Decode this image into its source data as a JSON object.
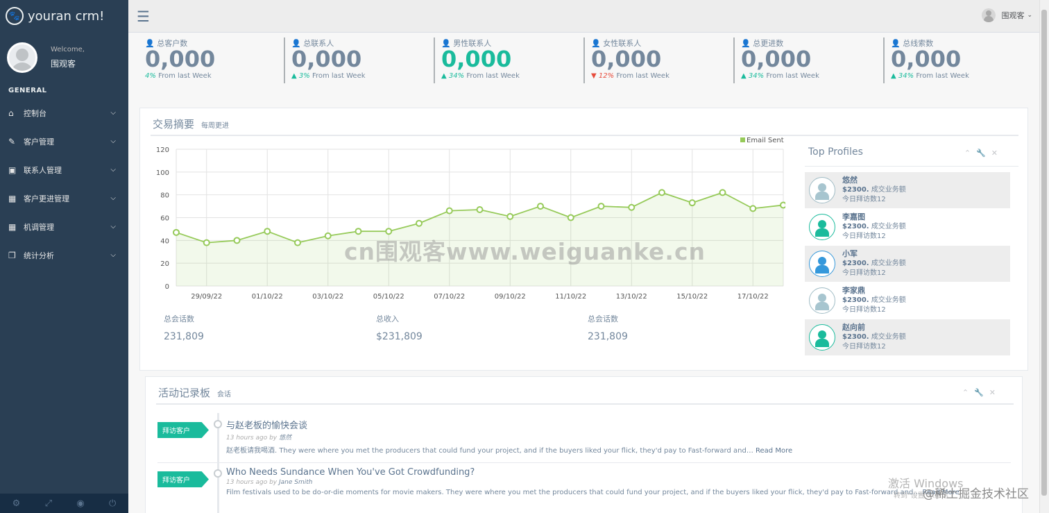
{
  "brand": {
    "icon": "paw-icon",
    "title": "youran crm!"
  },
  "profile": {
    "welcome": "Welcome,",
    "name": "围观客"
  },
  "sidebar": {
    "section": "GENERAL",
    "items": [
      {
        "label": "控制台",
        "icon": "home-icon"
      },
      {
        "label": "客户管理",
        "icon": "edit-icon"
      },
      {
        "label": "联系人管理",
        "icon": "desktop-icon"
      },
      {
        "label": "客户更进管理",
        "icon": "table-icon"
      },
      {
        "label": "机调管理",
        "icon": "table-icon"
      },
      {
        "label": "统计分析",
        "icon": "clone-icon"
      }
    ],
    "footer_icons": [
      "gear-icon",
      "fullscreen-icon",
      "eye-slash-icon",
      "power-icon"
    ]
  },
  "topnav": {
    "user": "围观客"
  },
  "stats": [
    {
      "title": "总客户数",
      "value": "0,000",
      "change": "4%",
      "dir": "none",
      "suffix": "From last Week",
      "green": false
    },
    {
      "title": "总联系人",
      "value": "0,000",
      "change": "3%",
      "dir": "up",
      "suffix": "From last Week",
      "green": false
    },
    {
      "title": "男性联系人",
      "value": "0,000",
      "change": "34%",
      "dir": "up",
      "suffix": "From last Week",
      "green": true
    },
    {
      "title": "女性联系人",
      "value": "0,000",
      "change": "12%",
      "dir": "down",
      "suffix": "From last Week",
      "green": false
    },
    {
      "title": "总更进数",
      "value": "0,000",
      "change": "34%",
      "dir": "up",
      "suffix": "From last Week",
      "green": false
    },
    {
      "title": "总线索数",
      "value": "0,000",
      "change": "34%",
      "dir": "up",
      "suffix": "From last Week",
      "green": false
    }
  ],
  "trade": {
    "title": "交易摘要",
    "subtitle": "每周更进",
    "summary": [
      {
        "label": "总会话数",
        "value": "231,809"
      },
      {
        "label": "总收入",
        "value": "$231,809"
      },
      {
        "label": "总会话数",
        "value": "231,809"
      }
    ]
  },
  "chart_data": {
    "type": "area",
    "title": "",
    "xlabel": "",
    "ylabel": "",
    "ylim": [
      0,
      120
    ],
    "yticks": [
      0,
      20,
      40,
      60,
      80,
      100,
      120
    ],
    "x": [
      "28/09/22",
      "29/09/22",
      "30/09/22",
      "01/10/22",
      "02/10/22",
      "03/10/22",
      "04/10/22",
      "05/10/22",
      "06/10/22",
      "07/10/22",
      "08/10/22",
      "09/10/22",
      "10/10/22",
      "11/10/22",
      "12/10/22",
      "13/10/22",
      "14/10/22",
      "15/10/22",
      "16/10/22",
      "17/10/22",
      "18/10/22"
    ],
    "xtick_labels": [
      "29/09/22",
      "01/10/22",
      "03/10/22",
      "05/10/22",
      "07/10/22",
      "09/10/22",
      "11/10/22",
      "13/10/22",
      "15/10/22",
      "17/10/22"
    ],
    "series": [
      {
        "name": "Email Sent",
        "color": "#96CA59",
        "values": [
          47,
          38,
          40,
          48,
          38,
          44,
          48,
          48,
          55,
          66,
          67,
          61,
          70,
          60,
          70,
          69,
          82,
          73,
          82,
          68,
          71
        ]
      }
    ],
    "grid": true,
    "legend": "top-right"
  },
  "top_profiles": {
    "title": "Top Profiles",
    "tools": [
      "chevron-up-icon",
      "wrench-icon",
      "close-icon"
    ],
    "items": [
      {
        "name": "悠然",
        "amount": "$2300.",
        "desc": "成交业务额",
        "visits": "今日拜访数12",
        "color": "#A7C5CF",
        "gray": true
      },
      {
        "name": "李嘉图",
        "amount": "$2300.",
        "desc": "成交业务额",
        "visits": "今日拜访数12",
        "color": "#1ABB9C",
        "gray": false
      },
      {
        "name": "小军",
        "amount": "$2300.",
        "desc": "成交业务额",
        "visits": "今日拜访数12",
        "color": "#3498DB",
        "gray": true
      },
      {
        "name": "李家鼎",
        "amount": "$2300.",
        "desc": "成交业务额",
        "visits": "今日拜访数12",
        "color": "#A7C5CF",
        "gray": false
      },
      {
        "name": "赵向前",
        "amount": "$2300.",
        "desc": "成交业务额",
        "visits": "今日拜访数12",
        "color": "#1ABB9C",
        "gray": true
      }
    ]
  },
  "activity": {
    "title": "活动记录板",
    "subtitle": "会话",
    "items": [
      {
        "tag": "拜访客户",
        "title": "与赵老板的愉快会谈",
        "time": "13 hours ago by",
        "by": "悠然",
        "body": "赵老板请我喝酒. They were where you met the producers that could fund your project, and if the buyers liked your flick, they'd pay to Fast-forward and…",
        "more": "Read More"
      },
      {
        "tag": "拜访客户",
        "title": "Who Needs Sundance When You've Got Crowdfunding?",
        "time": "13 hours ago by",
        "by": "Jane Smith",
        "body": "Film festivals used to be do-or-die moments for movie makers. They were where you met the producers that could fund your project, and if the buyers liked your flick, they'd pay to Fast-forward and…",
        "more": "Read More"
      }
    ]
  },
  "watermarks": {
    "site": "cn围观客www.weiguanke.cn",
    "windows": "激活 Windows",
    "windows_sub": "转到\"设置\"以激活",
    "juejin": "@稀土掘金技术社区"
  }
}
